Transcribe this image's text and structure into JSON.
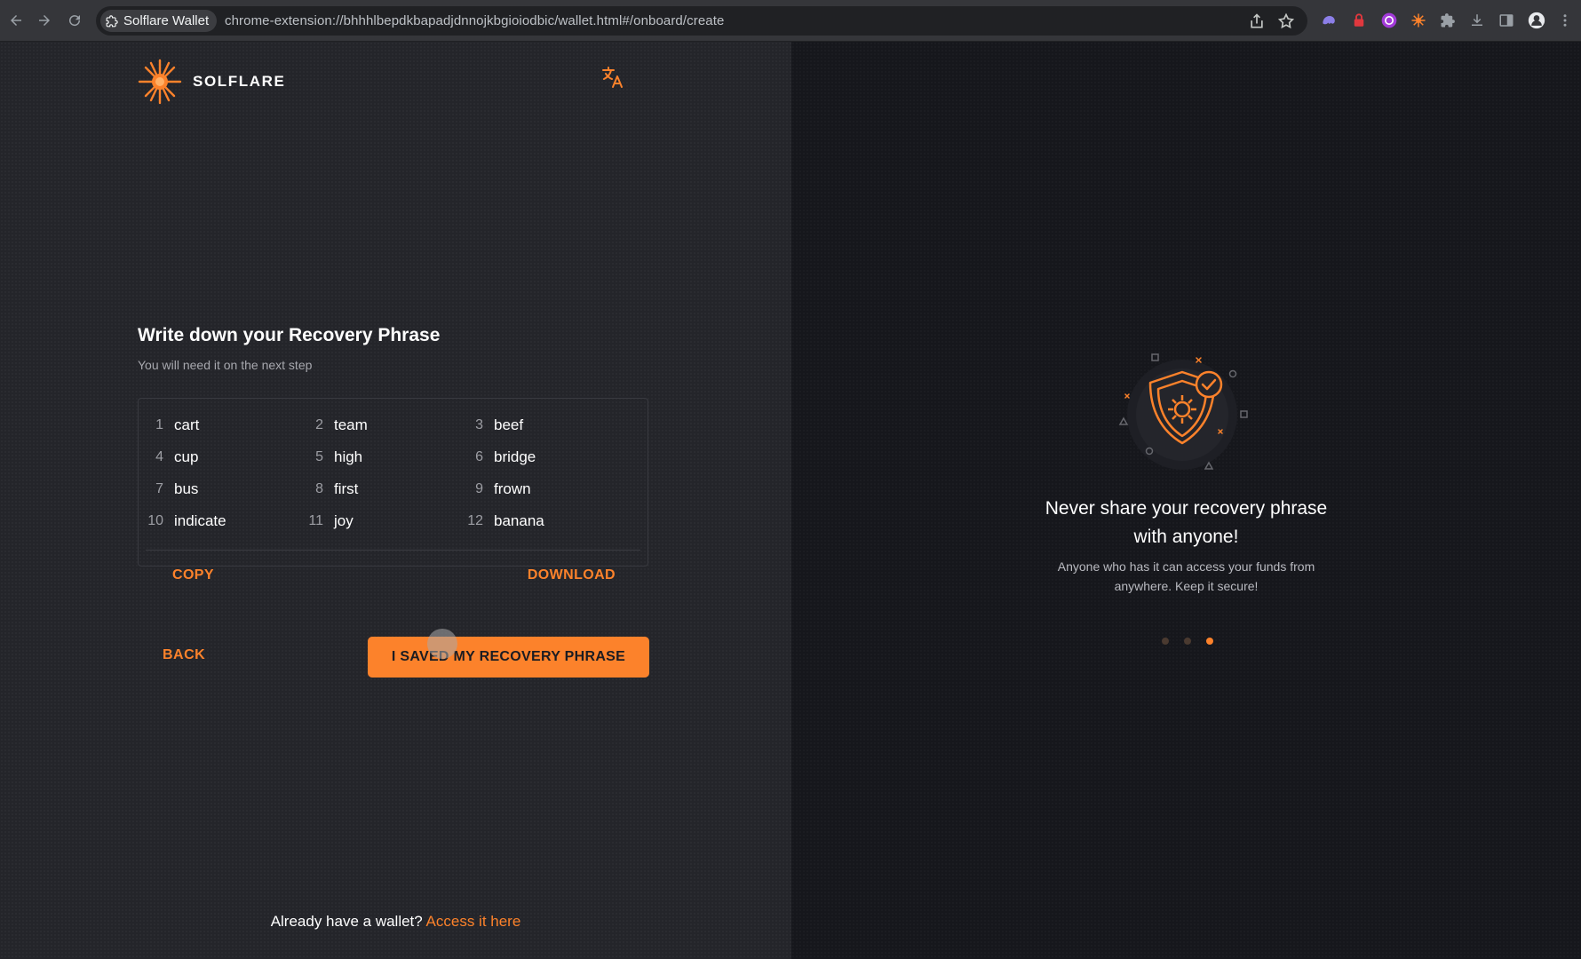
{
  "browser": {
    "tab_chip_label": "Solflare Wallet",
    "url": "chrome-extension://bhhhlbepdkbapadjdnnojkbgioiodbic/wallet.html#/onboard/create"
  },
  "brand": {
    "name": "SOLFLARE",
    "accent": "#fc822b"
  },
  "main": {
    "title": "Write down your Recovery Phrase",
    "subtitle": "You will need it on the next step",
    "words": [
      {
        "num": "1",
        "word": "cart"
      },
      {
        "num": "2",
        "word": "team"
      },
      {
        "num": "3",
        "word": "beef"
      },
      {
        "num": "4",
        "word": "cup"
      },
      {
        "num": "5",
        "word": "high"
      },
      {
        "num": "6",
        "word": "bridge"
      },
      {
        "num": "7",
        "word": "bus"
      },
      {
        "num": "8",
        "word": "first"
      },
      {
        "num": "9",
        "word": "frown"
      },
      {
        "num": "10",
        "word": "indicate"
      },
      {
        "num": "11",
        "word": "joy"
      },
      {
        "num": "12",
        "word": "banana"
      }
    ],
    "copy_label": "COPY",
    "download_label": "DOWNLOAD",
    "back_label": "BACK",
    "saved_label": "I SAVED MY RECOVERY PHRASE"
  },
  "footer": {
    "text": "Already have a wallet?",
    "link": "Access it here"
  },
  "side": {
    "title_line1": "Never share your recovery phrase",
    "title_line2": "with anyone!",
    "desc_line1": "Anyone who has it can access your funds from",
    "desc_line2": "anywhere. Keep it secure!",
    "carousel_active_index": 3,
    "carousel_count": 3
  }
}
